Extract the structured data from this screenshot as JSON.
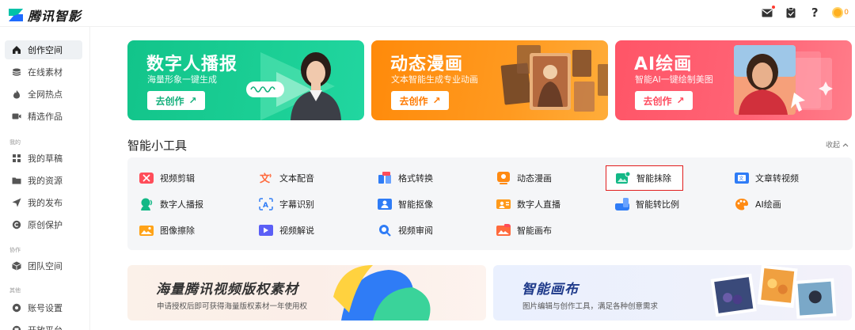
{
  "app": {
    "name": "腾讯智影"
  },
  "topbar": {
    "icons": [
      "mail-icon",
      "clipboard-icon",
      "help-icon",
      "coin-icon"
    ],
    "help_label": "?",
    "coin_count": "0"
  },
  "sidebar": {
    "items": [
      {
        "label": "创作空间",
        "icon": "home-icon",
        "active": true
      },
      {
        "label": "在线素材",
        "icon": "layers-icon"
      },
      {
        "label": "全网热点",
        "icon": "flame-icon"
      },
      {
        "label": "精选作品",
        "icon": "video-icon"
      }
    ],
    "section_mine": "我的",
    "mine_items": [
      {
        "label": "我的草稿",
        "icon": "grid-icon"
      },
      {
        "label": "我的资源",
        "icon": "folder-icon"
      },
      {
        "label": "我的发布",
        "icon": "send-icon"
      },
      {
        "label": "原创保护",
        "icon": "copyright-icon"
      }
    ],
    "section_collab": "协作",
    "collab_items": [
      {
        "label": "团队空间",
        "icon": "cube-icon"
      }
    ],
    "section_other": "其他",
    "other_items": [
      {
        "label": "账号设置",
        "icon": "gear-icon"
      },
      {
        "label": "开放平台",
        "icon": "platform-icon"
      }
    ]
  },
  "banners": [
    {
      "title": "数字人播报",
      "subtitle": "海量形象一键生成",
      "button": "去创作",
      "color": "#14c58a",
      "btn_text_color": "#14b07c"
    },
    {
      "title": "动态漫画",
      "subtitle": "文本智能生成专业动画",
      "button": "去创作",
      "color": "#ff8a12",
      "btn_text_color": "#ff7a00"
    },
    {
      "title": "AI绘画",
      "subtitle": "智能AI一键绘制美图",
      "button": "去创作",
      "color": "#ff5a6e",
      "btn_text_color": "#ff4a5e"
    }
  ],
  "tools_section": {
    "title": "智能小工具",
    "collapse_label": "收起",
    "tools": [
      {
        "label": "视频剪辑",
        "icon": "video-edit-icon",
        "color": "#ff4d5a"
      },
      {
        "label": "文本配音",
        "icon": "text-voice-icon",
        "color": "#ff6a3d"
      },
      {
        "label": "格式转换",
        "icon": "format-convert-icon",
        "color": "#2f7cf6"
      },
      {
        "label": "动态漫画",
        "icon": "comic-icon",
        "color": "#ff8a12"
      },
      {
        "label": "智能抹除",
        "icon": "erase-icon",
        "color": "#12b886",
        "selected": true
      },
      {
        "label": "文章转视频",
        "icon": "article-video-icon",
        "color": "#2f7cf6"
      },
      {
        "label": "数字人播报",
        "icon": "digital-human-icon",
        "color": "#12b886"
      },
      {
        "label": "字幕识别",
        "icon": "subtitle-icon",
        "color": "#2f7cf6"
      },
      {
        "label": "智能抠像",
        "icon": "matting-icon",
        "color": "#2f7cf6"
      },
      {
        "label": "数字人直播",
        "icon": "live-icon",
        "color": "#ff9a1a"
      },
      {
        "label": "智能转比例",
        "icon": "ratio-icon",
        "color": "#2f7cf6"
      },
      {
        "label": "AI绘画",
        "icon": "palette-icon",
        "color": "#ff8a12"
      },
      {
        "label": "图像擦除",
        "icon": "image-erase-icon",
        "color": "#ffa318"
      },
      {
        "label": "视频解说",
        "icon": "narration-icon",
        "color": "#5b5ff6"
      },
      {
        "label": "视频审阅",
        "icon": "review-icon",
        "color": "#2f7cf6"
      },
      {
        "label": "智能画布",
        "icon": "canvas-icon",
        "color": "#ff6a3d"
      }
    ]
  },
  "bottom_banners": [
    {
      "title": "海量腾讯视频版权素材",
      "subtitle": "申请授权后即可获得海量版权素材一年使用权"
    },
    {
      "title": "智能画布",
      "subtitle": "图片编辑与创作工具，满足各种创意需求"
    }
  ]
}
